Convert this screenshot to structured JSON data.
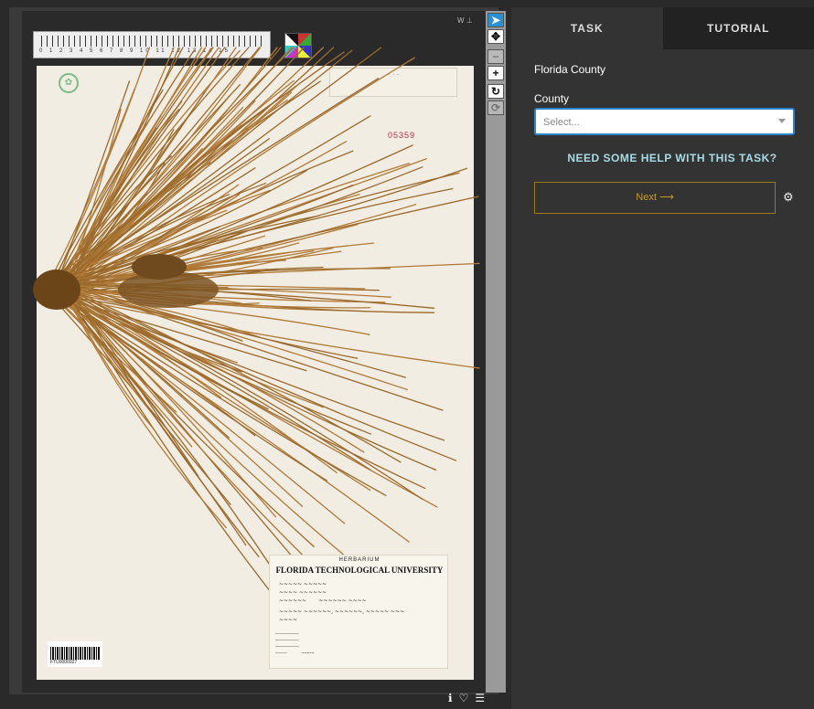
{
  "panel": {
    "tabs": [
      {
        "label": "TASK",
        "active": true
      },
      {
        "label": "TUTORIAL",
        "active": false
      }
    ],
    "task_title": "Florida County",
    "field_label": "County",
    "select_placeholder": "Select...",
    "help_link": "NEED SOME HELP WITH THIS TASK?",
    "next_label": "Next ⟶",
    "settings_icon": "gear-icon"
  },
  "viewer": {
    "tools": [
      "pointer-icon",
      "pan-icon",
      "zoom-out-icon",
      "zoom-in-icon",
      "rotate-icon",
      "reset-icon"
    ],
    "footer_icons": [
      "info-icon",
      "favorite-icon",
      "collections-icon"
    ],
    "accession_number": "05359",
    "barcode_text": "FTU0000927",
    "label": {
      "herbarium": "HERBARIUM",
      "university": "FLORIDA TECHNOLOGICAL UNIVERSITY"
    }
  },
  "colors": {
    "accent_blue": "#2e86c8",
    "help_text": "#a6dce6",
    "next_border": "#9c7a1c",
    "panel_bg": "#333333"
  }
}
